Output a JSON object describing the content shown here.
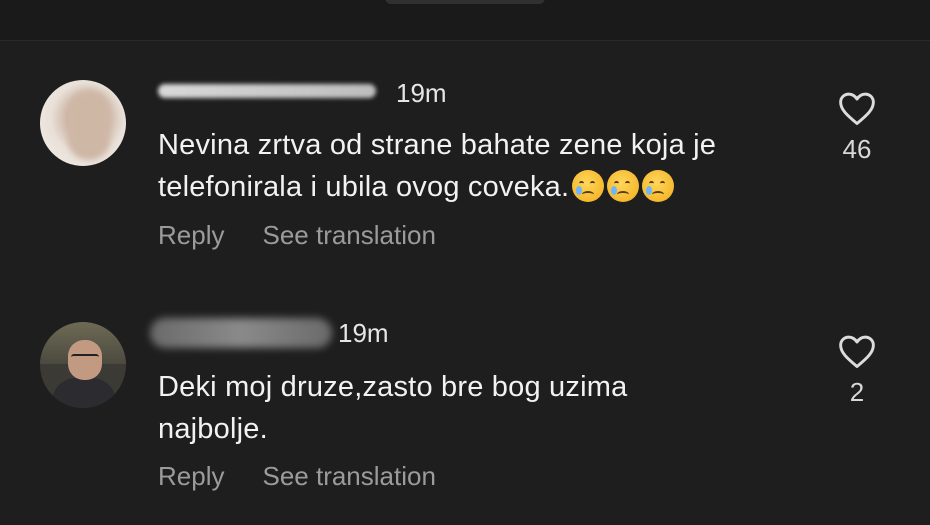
{
  "header": {
    "partial_text": ""
  },
  "comments": [
    {
      "username_visible": "",
      "time": "19m",
      "text_line1": "Nevina zrtva od strane bahate zene koja je",
      "text_line2": "telefonirala i ubila ovog coveka.",
      "emojis": [
        "crying-face",
        "crying-face",
        "crying-face"
      ],
      "reply_label": "Reply",
      "translate_label": "See translation",
      "like_count": "46"
    },
    {
      "username_visible": "",
      "time": "19m",
      "text_line1": "Deki moj druze,zasto bre bog uzima",
      "text_line2": "najbolje.",
      "reply_label": "Reply",
      "translate_label": "See translation",
      "like_count": "2"
    }
  ],
  "icons": {
    "like": "heart-outline-icon",
    "emoji": "crying-face-emoji"
  },
  "colors": {
    "background": "#1e1e1e",
    "text": "#f2f2f2",
    "muted": "#9b9b9b"
  }
}
